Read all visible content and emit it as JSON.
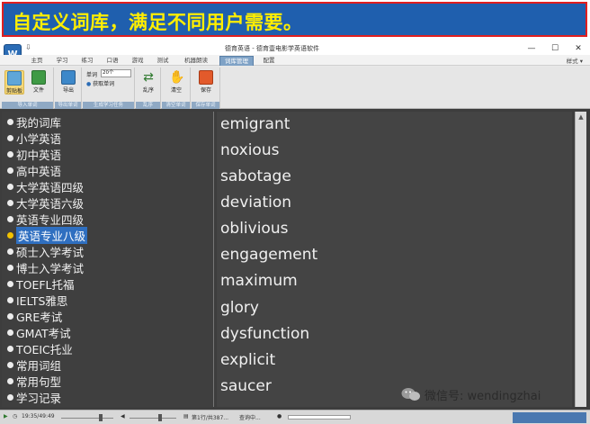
{
  "banner": {
    "title": "自定义词库，满足不同用户需要。"
  },
  "window": {
    "title": "德育英语 - 德育壹电影学英语软件",
    "minimize": "—",
    "maximize": "☐",
    "close": "✕"
  },
  "menu": {
    "tabs": [
      "主页",
      "学习",
      "练习",
      "口语",
      "游戏",
      "测试",
      "机器朗读",
      "词库管理",
      "配置"
    ],
    "active_tab": "词库管理",
    "style_label": "样式 ▾"
  },
  "ribbon": {
    "groups": [
      {
        "label": "导入单词",
        "buttons": [
          "剪贴板",
          "文件"
        ]
      },
      {
        "label": "导出单词",
        "buttons": [
          "导出"
        ]
      },
      {
        "label": "生成学习任务",
        "word_label": "单词",
        "word_count": "20个",
        "fetch": "获取单词"
      },
      {
        "label": "乱序",
        "buttons": [
          "乱序"
        ]
      },
      {
        "label": "清空单词",
        "buttons": [
          "清空"
        ]
      },
      {
        "label": "保存单词",
        "buttons": [
          "保存"
        ]
      }
    ]
  },
  "library": {
    "items": [
      "我的词库",
      "小学英语",
      "初中英语",
      "高中英语",
      "大学英语四级",
      "大学英语六级",
      "英语专业四级",
      "英语专业八级",
      "硕士入学考试",
      "博士入学考试",
      "TOEFL托福",
      "IELTS雅思",
      "GRE考试",
      "GMAT考试",
      "TOEIC托业",
      "常用词组",
      "常用句型",
      "学习记录"
    ],
    "selected": "英语专业八级"
  },
  "words": [
    "emigrant",
    "noxious",
    "sabotage",
    "deviation",
    "oblivious",
    "engagement",
    "maximum",
    "glory",
    "dysfunction",
    "explicit",
    "saucer"
  ],
  "status": {
    "time": "19:35/49:49",
    "page": "第1行/共387...",
    "search": "查询中..."
  },
  "watermark": {
    "text": "微信号: wendingzhai"
  },
  "colors": {
    "banner_bg": "#1f5fae",
    "banner_text": "#ffee00",
    "banner_border": "#e11f1f",
    "select_bg": "#2f6fc0"
  }
}
